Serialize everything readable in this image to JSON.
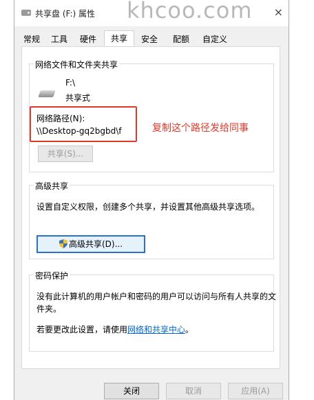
{
  "window": {
    "title": "共享盘 (F:) 属性",
    "watermark": "khcoo.com",
    "close_glyph": "×"
  },
  "tabs": [
    {
      "label": "常规"
    },
    {
      "label": "工具"
    },
    {
      "label": "硬件"
    },
    {
      "label": "共享",
      "active": true
    },
    {
      "label": "安全"
    },
    {
      "label": "配额"
    },
    {
      "label": "自定义"
    }
  ],
  "network_sharing": {
    "group_title": "网络文件和文件夹共享",
    "drive_name": "F:\\",
    "drive_status": "共享式",
    "path_label": "网络路径(N):",
    "path_value": "\\\\Desktop-gq2bgbd\\f",
    "share_button": "共享(S)...",
    "annotation": "复制这个路径发给同事"
  },
  "advanced_sharing": {
    "group_title": "高级共享",
    "description": "设置自定义权限，创建多个共享，并设置其他高级共享选项。",
    "button": "高级共享(D)..."
  },
  "password_protection": {
    "group_title": "密码保护",
    "description_line1": "没有此计算机的用户帐户和密码的用户可以访问与所有人共享的文",
    "description_line2": "件夹。",
    "change_prefix": "若要更改此设置，请使用",
    "link_text": "网络和共享中心",
    "change_suffix": "。"
  },
  "footer": {
    "close": "关闭",
    "cancel": "取消",
    "apply": "应用(A)"
  },
  "colors": {
    "annotation_red": "#e2382a",
    "link_blue": "#0066cc",
    "focus_blue": "#2a6fc9"
  }
}
